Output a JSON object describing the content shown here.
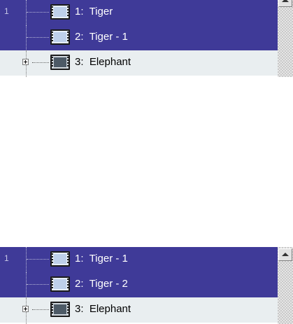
{
  "panels": [
    {
      "line_number": "1",
      "items": [
        {
          "label": "1:  Tiger"
        },
        {
          "label": "2:  Tiger - 1"
        },
        {
          "label": "3:  Elephant"
        }
      ]
    },
    {
      "line_number": "1",
      "items": [
        {
          "label": "1:  Tiger - 1"
        },
        {
          "label": "2:  Tiger - 2"
        },
        {
          "label": "3:  Elephant"
        }
      ]
    }
  ],
  "colors": {
    "selected_bg": "#3f3a98",
    "selected_text": "#ffffff",
    "unselected_bg": "#e9eef0"
  },
  "icons": {
    "item": "film-clip-icon",
    "expander": "expand-plus-icon",
    "scroll_up": "arrow-up-icon"
  }
}
